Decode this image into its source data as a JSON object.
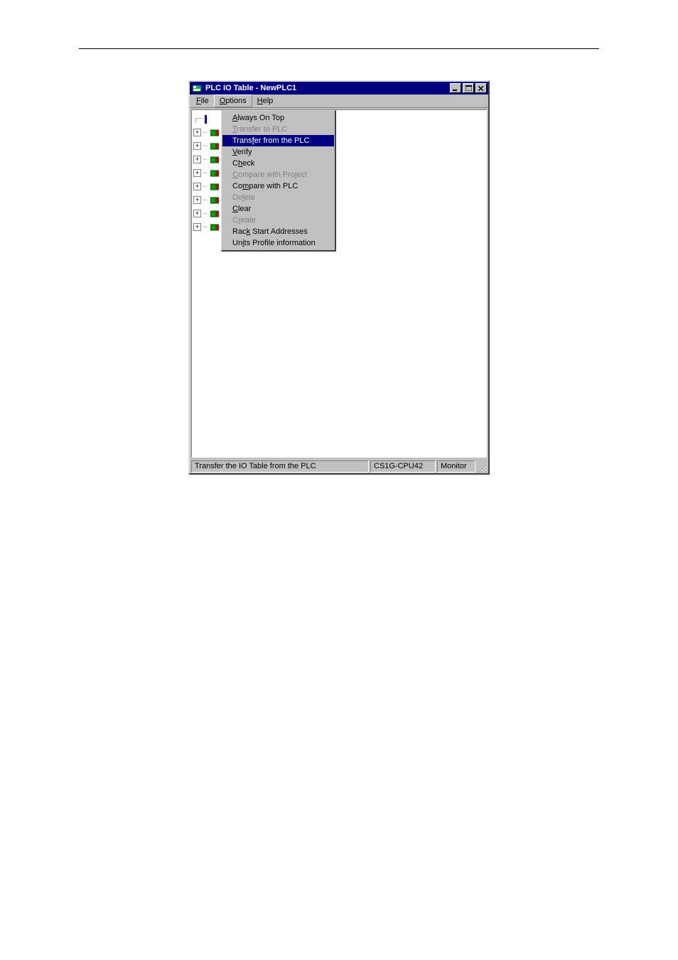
{
  "window": {
    "title": "PLC IO Table - NewPLC1"
  },
  "menubar": {
    "file": {
      "label": "File",
      "ul": "F"
    },
    "options": {
      "label": "Options",
      "ul": "O"
    },
    "help": {
      "label": "Help",
      "ul": "H"
    }
  },
  "tree": {
    "plus": "+",
    "rows": 8
  },
  "options_menu": {
    "items": [
      {
        "label": "Always On Top",
        "ul": "A",
        "state": "enabled"
      },
      {
        "label": "Transfer to PLC",
        "ul": "T",
        "state": "disabled"
      },
      {
        "label": "Transfer from the PLC",
        "ul": "f",
        "state": "highlight"
      },
      {
        "label": "Verify",
        "ul": "V",
        "state": "enabled"
      },
      {
        "label": "Check",
        "ul": "h",
        "state": "enabled"
      },
      {
        "label": "Compare with Project",
        "ul": "C",
        "state": "disabled"
      },
      {
        "label": "Compare with PLC",
        "ul": "m",
        "state": "enabled"
      },
      {
        "label": "Delete",
        "ul": "l",
        "state": "disabled"
      },
      {
        "label": "Clear",
        "ul": "C",
        "state": "enabled"
      },
      {
        "label": "Create",
        "ul": "r",
        "state": "disabled"
      },
      {
        "label": "Rack Start Addresses",
        "ul": "k",
        "state": "enabled"
      },
      {
        "label": "Units Profile information",
        "ul": "i",
        "state": "enabled"
      }
    ]
  },
  "statusbar": {
    "hint": "Transfer the IO Table from the PLC",
    "cpu": "CS1G-CPU42",
    "mode": "Monitor"
  }
}
